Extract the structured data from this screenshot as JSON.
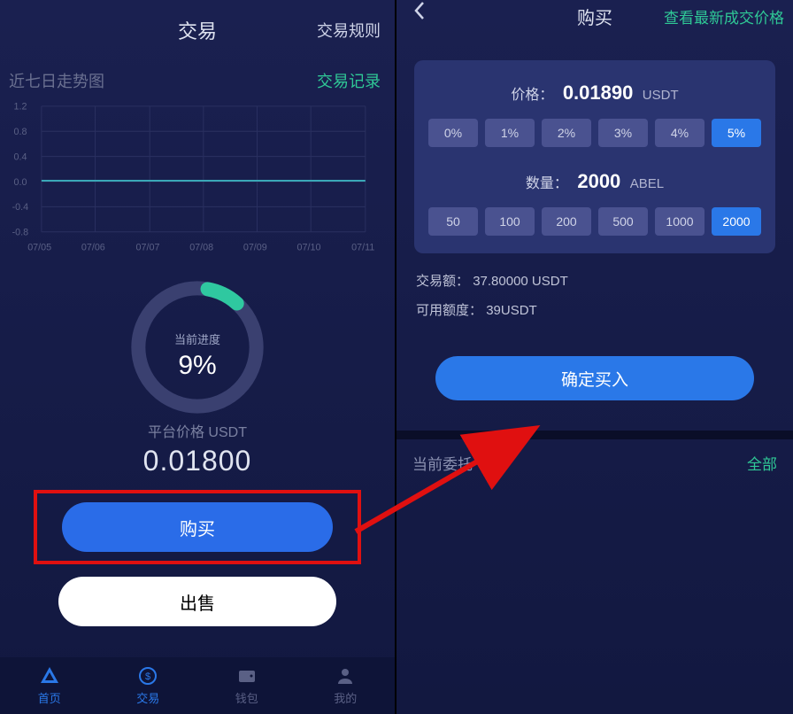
{
  "left": {
    "header_title": "交易",
    "trade_rules": "交易规则",
    "chart_title": "近七日走势图",
    "trade_records": "交易记录",
    "progress_label": "当前进度",
    "progress_percent": "9%",
    "price_label": "平台价格 USDT",
    "price_value": "0.01800",
    "buy_label": "购买",
    "sell_label": "出售"
  },
  "nav": {
    "home": "首页",
    "trade": "交易",
    "wallet": "钱包",
    "mine": "我的"
  },
  "right": {
    "header_title": "购买",
    "view_latest": "查看最新成交价格",
    "price_label": "价格：",
    "price_value": "0.01890",
    "price_unit": "USDT",
    "percent_options": [
      "0%",
      "1%",
      "2%",
      "3%",
      "4%",
      "5%"
    ],
    "percent_selected": "5%",
    "qty_label": "数量：",
    "qty_value": "2000",
    "qty_unit": "ABEL",
    "qty_options": [
      "50",
      "100",
      "200",
      "500",
      "1000",
      "2000"
    ],
    "qty_selected": "2000",
    "amount_label": "交易额：",
    "amount_value": "37.80000 USDT",
    "available_label": "可用额度：",
    "available_value": "39USDT",
    "confirm_label": "确定买入",
    "orders_title": "当前委托",
    "orders_all": "全部"
  },
  "chart_data": {
    "type": "line",
    "title": "近七日走势图",
    "xlabel": "",
    "ylabel": "",
    "ylim": [
      -0.8,
      1.2
    ],
    "y_ticks": [
      1.2,
      0.8,
      0.4,
      0.0,
      -0.4,
      -0.8
    ],
    "categories": [
      "07/05",
      "07/06",
      "07/07",
      "07/08",
      "07/09",
      "07/10",
      "07/11"
    ],
    "values": [
      0.018,
      0.018,
      0.018,
      0.018,
      0.018,
      0.018,
      0.018
    ]
  }
}
